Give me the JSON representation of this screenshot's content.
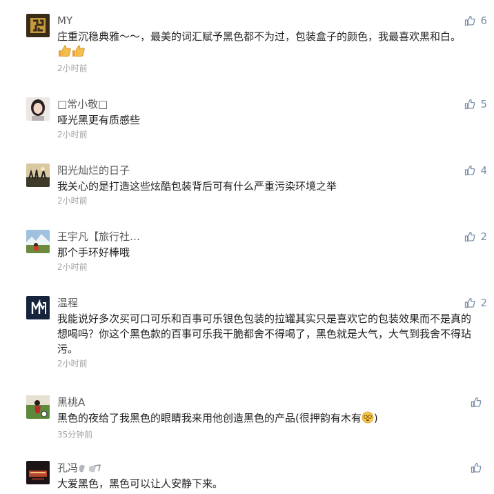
{
  "comments": [
    {
      "username": "MY",
      "text": "庄重沉稳典雅～～，最美的词汇赋予黑色都不为过，包装盒子的颜色，我最喜欢黑和白。",
      "emoji": "thumbs-up-icon thumbs-up-icon",
      "time": "2小时前",
      "likes": "6"
    },
    {
      "username": "□常小敬□",
      "text": "哑光黑更有质感些",
      "time": "2小时前",
      "likes": "5"
    },
    {
      "username": "阳光灿烂的日子",
      "text": "我关心的是打造这些炫酷包装背后可有什么严重污染环境之举",
      "time": "2小时前",
      "likes": "4"
    },
    {
      "username": "王宇凡【旅行社…",
      "text": "那个手环好棒哦",
      "time": "2小时前",
      "likes": "2"
    },
    {
      "username": "温程",
      "text": "我能说好多次买可口可乐和百事可乐银色包装的拉罐其实只是喜欢它的包装效果而不是真的想喝吗？你这个黑色款的百事可乐我干脆都舍不得喝了，黑色就是大气，大气到我舍不得玷污。",
      "time": "2小时前",
      "likes": "2"
    },
    {
      "username": "黑桃A",
      "text": "黑色的夜给了我黑色的眼睛我来用他创造黑色的产品(很押韵有木有",
      "text_tail": ")",
      "emoji": "dizzy-face-icon",
      "time": "35分钟前",
      "likes": ""
    },
    {
      "username": "孔冯",
      "username_emoji": "clap-hands-icon",
      "text": "大爱黑色，黑色可以让人安静下来。",
      "time": "",
      "likes": ""
    }
  ]
}
